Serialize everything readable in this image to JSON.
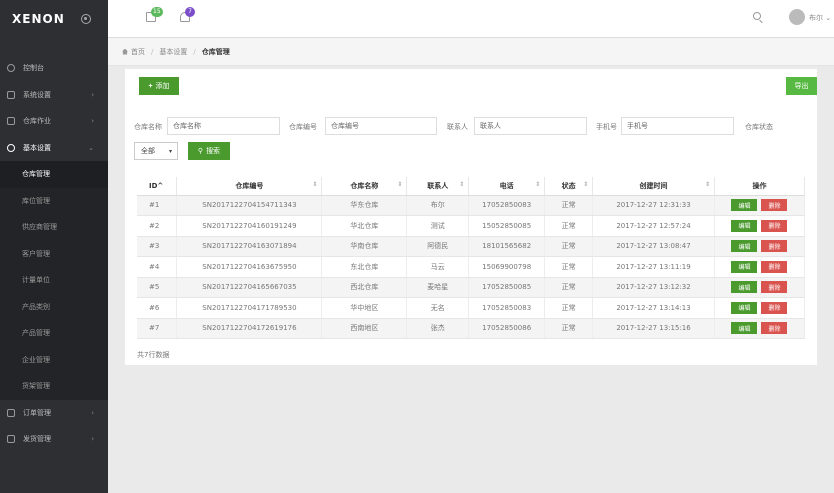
{
  "brand": "XENON",
  "topbar": {
    "mail_badge": "15",
    "bell_badge": "7",
    "username": "布尔"
  },
  "sidebar": {
    "items": [
      {
        "label": "控制台"
      },
      {
        "label": "系统设置"
      },
      {
        "label": "仓库作业"
      },
      {
        "label": "基本设置"
      }
    ],
    "sub_items": [
      {
        "label": "仓库管理"
      },
      {
        "label": "库位管理"
      },
      {
        "label": "供应商管理"
      },
      {
        "label": "客户管理"
      },
      {
        "label": "计量单位"
      },
      {
        "label": "产品类别"
      },
      {
        "label": "产品管理"
      },
      {
        "label": "企业管理"
      },
      {
        "label": "货架管理"
      }
    ],
    "bottom_items": [
      {
        "label": "订单管理"
      },
      {
        "label": "发货管理"
      }
    ]
  },
  "breadcrumb": {
    "home": "首页",
    "level2": "基本设置",
    "current": "仓库管理"
  },
  "toolbar": {
    "add_label": "添加",
    "export_label": "导出"
  },
  "filters": {
    "name_label": "仓库名称",
    "name_placeholder": "仓库名称",
    "code_label": "仓库编号",
    "code_placeholder": "仓库编号",
    "contact_label": "联系人",
    "contact_placeholder": "联系人",
    "phone_label": "手机号",
    "phone_placeholder": "手机号",
    "status_label": "仓库状态",
    "status_value": "全部",
    "search_label": "搜索"
  },
  "table": {
    "headers": [
      "ID",
      "仓库编号",
      "仓库名称",
      "联系人",
      "电话",
      "状态",
      "创建时间",
      "操作"
    ],
    "edit_label": "编辑",
    "delete_label": "删除",
    "rows": [
      [
        "#1",
        "SN2017122704154711343",
        "华东仓库",
        "布尔",
        "17052850083",
        "正常",
        "2017-12-27 12:31:33"
      ],
      [
        "#2",
        "SN2017122704160191249",
        "华北仓库",
        "测试",
        "15052850085",
        "正常",
        "2017-12-27 12:57:24"
      ],
      [
        "#3",
        "SN2017122704163071894",
        "华南仓库",
        "阿德民",
        "18101565682",
        "正常",
        "2017-12-27 13:08:47"
      ],
      [
        "#4",
        "SN2017122704163675950",
        "东北仓库",
        "马云",
        "15069900798",
        "正常",
        "2017-12-27 13:11:19"
      ],
      [
        "#5",
        "SN2017122704165667035",
        "西北仓库",
        "麦哈星",
        "17052850085",
        "正常",
        "2017-12-27 13:12:32"
      ],
      [
        "#6",
        "SN2017122704171789530",
        "华中地区",
        "无名",
        "17052850083",
        "正常",
        "2017-12-27 13:14:13"
      ],
      [
        "#7",
        "SN2017122704172619176",
        "西南地区",
        "张杰",
        "17052850086",
        "正常",
        "2017-12-27 13:15:16"
      ]
    ]
  },
  "footer_total": "共7行数据"
}
